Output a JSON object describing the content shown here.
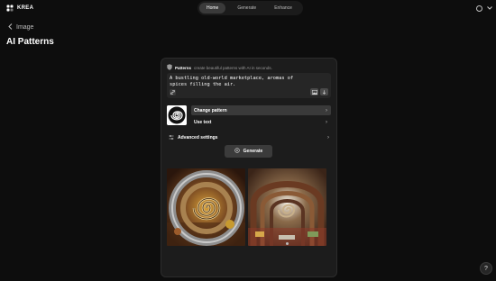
{
  "app": {
    "logo_text": "KREA"
  },
  "nav": {
    "tabs": [
      {
        "label": "Home",
        "active": true
      },
      {
        "label": "Generate"
      },
      {
        "label": "Enhance"
      }
    ]
  },
  "breadcrumb": {
    "back_label": "Image"
  },
  "page": {
    "title": "AI Patterns"
  },
  "panel": {
    "title": "Patterns",
    "subtitle": "create beautiful patterns with AI in seconds.",
    "prompt_text": "A bustling old-world marketplace, aromas of spices filling the air.",
    "options": [
      {
        "label": "Change pattern",
        "active": true
      },
      {
        "label": "Use text"
      }
    ],
    "advanced_label": "Advanced settings",
    "generate_label": "Generate"
  },
  "help": {
    "label": "?"
  },
  "colors": {
    "background": "#0d0d0d",
    "panel": "#1c1c1c",
    "active_row": "#3a3a3a"
  },
  "icons": [
    "krea-logo-icon",
    "chevron-down-icon",
    "chevron-left-icon",
    "shield-icon",
    "link-icon",
    "image-icon",
    "arrow-down-icon",
    "spiral-pattern-icon",
    "chevron-right-icon",
    "sliders-icon",
    "sparkle-icon",
    "help-icon"
  ]
}
